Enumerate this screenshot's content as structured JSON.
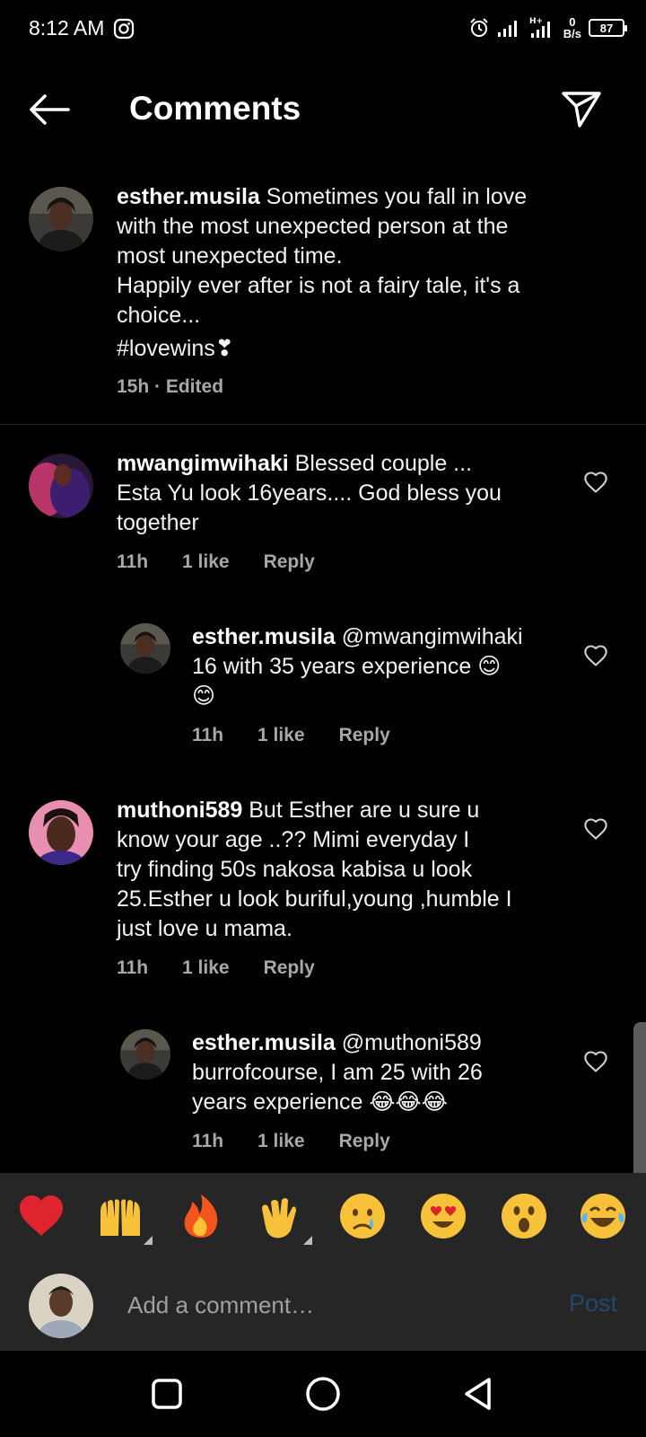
{
  "status_bar": {
    "time": "8:12 AM",
    "network_speed_value": "0",
    "network_speed_unit": "B/s",
    "battery": "87",
    "icons": [
      "instagram-icon",
      "alarm-icon",
      "signal-icon",
      "signal-h-plus-icon",
      "battery-icon"
    ]
  },
  "header": {
    "title": "Comments",
    "icons": [
      "back-arrow-icon",
      "send-icon"
    ]
  },
  "caption": {
    "username": "esther.musila",
    "lines": [
      "Sometimes you fall in love",
      "with the most unexpected person at the",
      "most unexpected time.",
      "Happily ever after is not a fairy tale, it's a",
      "choice..."
    ],
    "hashtag": "#lovewins❣",
    "meta": "15h · Edited"
  },
  "comments": [
    {
      "username": "mwangimwihaki",
      "lines": [
        "Blessed couple ...",
        "Esta Yu look 16years.... God bless you",
        "together"
      ],
      "time": "11h",
      "likes": "1 like",
      "reply": "Reply"
    },
    {
      "username": "esther.musila",
      "lines": [
        "@mwangimwihaki",
        "16 with 35 years experience 😊",
        "😊"
      ],
      "time": "11h",
      "likes": "1 like",
      "reply": "Reply"
    },
    {
      "username": "muthoni589",
      "lines": [
        "But Esther are u sure u",
        "know your age ..?? Mimi everyday I",
        "try finding 50s nakosa kabisa u look",
        "25.Esther u look buriful,young ,humble I",
        "just love u mama."
      ],
      "time": "11h",
      "likes": "1 like",
      "reply": "Reply"
    },
    {
      "username": "esther.musila",
      "lines": [
        "@muthoni589",
        "burrofcourse, I am 25 with 26",
        "years experience 😂😂😂"
      ],
      "time": "11h",
      "likes": "1 like",
      "reply": "Reply"
    }
  ],
  "emoji_bar": [
    "❤️",
    "🙌",
    "🔥",
    "👏",
    "😢",
    "😍",
    "😮",
    "😂"
  ],
  "comment_bar": {
    "placeholder": "Add a comment…",
    "post": "Post"
  },
  "nav_bar": {
    "icons": [
      "recents-square-icon",
      "home-circle-icon",
      "back-triangle-icon"
    ]
  },
  "colors": {
    "background": "#000000",
    "secondary_text": "#a8a8a8",
    "bar_background": "#262626",
    "post_disabled": "#23486e"
  }
}
